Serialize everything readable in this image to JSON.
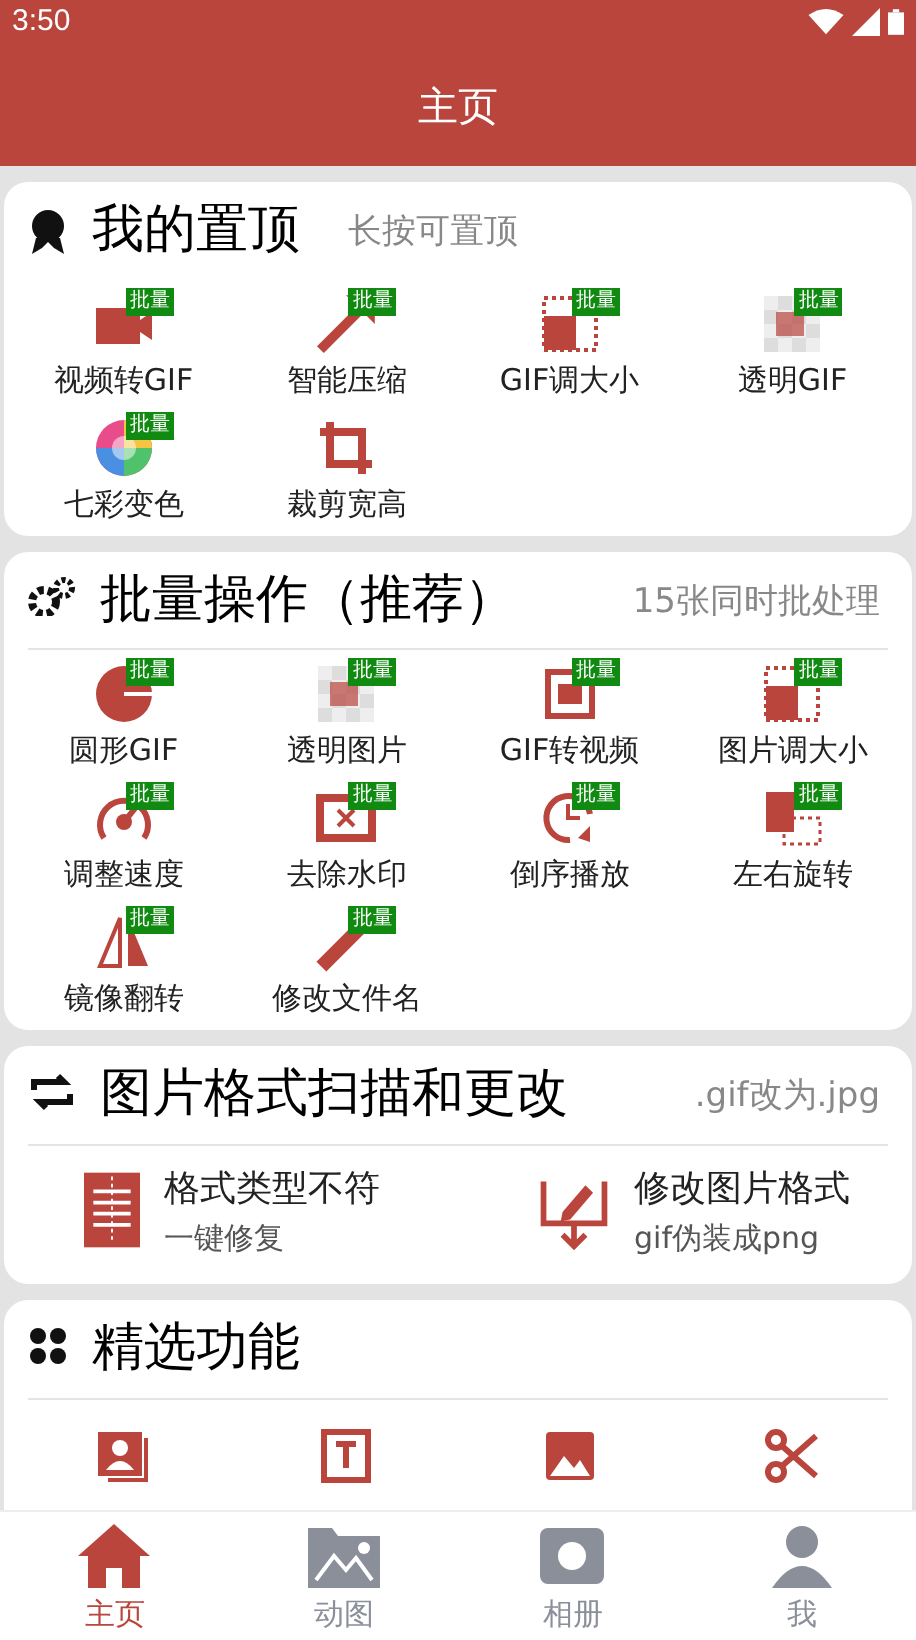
{
  "status_bar": {
    "time": "3:50"
  },
  "header": {
    "title": "主页"
  },
  "pinned": {
    "title": "我的置顶",
    "hint": "长按可置顶",
    "items": [
      {
        "label": "视频转GIF",
        "badge": "批量"
      },
      {
        "label": "智能压缩",
        "badge": "批量"
      },
      {
        "label": "GIF调大小",
        "badge": "批量"
      },
      {
        "label": "透明GIF",
        "badge": "批量"
      },
      {
        "label": "七彩变色",
        "badge": "批量"
      },
      {
        "label": "裁剪宽高"
      }
    ]
  },
  "batch": {
    "title": "批量操作（推荐）",
    "hint": "15张同时批处理",
    "items": [
      {
        "label": "圆形GIF",
        "badge": "批量"
      },
      {
        "label": "透明图片",
        "badge": "批量"
      },
      {
        "label": "GIF转视频",
        "badge": "批量"
      },
      {
        "label": "图片调大小",
        "badge": "批量"
      },
      {
        "label": "调整速度",
        "badge": "批量"
      },
      {
        "label": "去除水印",
        "badge": "批量"
      },
      {
        "label": "倒序播放",
        "badge": "批量"
      },
      {
        "label": "左右旋转",
        "badge": "批量"
      },
      {
        "label": "镜像翻转",
        "badge": "批量"
      },
      {
        "label": "修改文件名",
        "badge": "批量"
      }
    ]
  },
  "format": {
    "title": "图片格式扫描和更改",
    "hint": ".gif改为.jpg",
    "items": [
      {
        "title": "格式类型不符",
        "subtitle": "一键修复"
      },
      {
        "title": "修改图片格式",
        "subtitle": "gif伪装成png"
      }
    ]
  },
  "featured": {
    "title": "精选功能"
  },
  "tabs": [
    {
      "label": "主页",
      "selected": true
    },
    {
      "label": "动图",
      "selected": false
    },
    {
      "label": "相册",
      "selected": false
    },
    {
      "label": "我",
      "selected": false
    }
  ]
}
